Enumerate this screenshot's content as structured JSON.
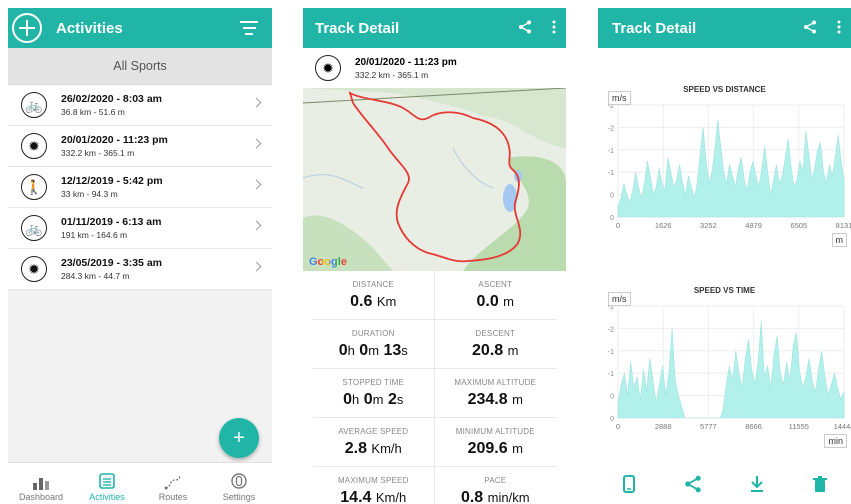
{
  "colors": {
    "accent": "#21b5a7",
    "track": "#e53935",
    "chart_fill": "#b2f0ec"
  },
  "screen1": {
    "title": "Activities",
    "subheader": "All Sports",
    "activities": [
      {
        "icon": "bicycle-icon",
        "date": "26/02/2020 - 8:03 am",
        "distance": "36.8 km - 51.6 m"
      },
      {
        "icon": "wheel-icon",
        "date": "20/01/2020 - 11:23 pm",
        "distance": "332.2 km - 365.1 m"
      },
      {
        "icon": "hiker-icon",
        "date": "12/12/2019 - 5:42 pm",
        "distance": "33 km - 94.3 m"
      },
      {
        "icon": "bicycle-icon",
        "date": "01/11/2019 - 6:13 am",
        "distance": "191 km - 164.6 m"
      },
      {
        "icon": "wheel-icon",
        "date": "23/05/2019 - 3:35 am",
        "distance": "284.3 km - 44.7 m"
      }
    ],
    "fab": "+",
    "nav": [
      {
        "label": "Dashboard",
        "icon": "bar-chart-icon"
      },
      {
        "label": "Activities",
        "icon": "list-icon"
      },
      {
        "label": "Routes",
        "icon": "route-icon"
      },
      {
        "label": "Settings",
        "icon": "settings-icon"
      }
    ]
  },
  "screen2": {
    "title": "Track Detail",
    "date": "20/01/2020 - 11:23 pm",
    "distance": "332.2 km - 365.1 m",
    "map_logo": "Google",
    "stats": [
      {
        "label": "DISTANCE",
        "value": "0.6",
        "unit": "Km"
      },
      {
        "label": "ASCENT",
        "value": "0.0",
        "unit": "m"
      },
      {
        "label": "DURATION",
        "h": "0",
        "m": "0",
        "s": "13"
      },
      {
        "label": "DESCENT",
        "value": "20.8",
        "unit": "m"
      },
      {
        "label": "STOPPED TIME",
        "h": "0",
        "m": "0",
        "s": "2"
      },
      {
        "label": "MAXIMUM ALTITUDE",
        "value": "234.8",
        "unit": "m"
      },
      {
        "label": "AVERAGE SPEED",
        "value": "2.8",
        "unit": "Km/h"
      },
      {
        "label": "MINIMUM ALTITUDE",
        "value": "209.6",
        "unit": "m"
      },
      {
        "label": "MAXIMUM SPEED",
        "value": "14.4",
        "unit": "Km/h"
      },
      {
        "label": "PACE",
        "value": "0.8",
        "unit": "min/km"
      }
    ],
    "time_units": {
      "h": "h",
      "m": "m",
      "s": "s"
    }
  },
  "screen3": {
    "title": "Track Detail",
    "chart_data": [
      {
        "type": "area",
        "title": "SPEED VS DISTANCE",
        "ylabel": "m/s",
        "xlabel": "m",
        "yticks": [
          "-2",
          "-2",
          "-1",
          "-1",
          "0",
          "0"
        ],
        "xticks": [
          "0",
          "1626",
          "3252",
          "4879",
          "6505",
          "8131"
        ],
        "xlim": [
          0,
          8131
        ],
        "series": [
          {
            "values": [
              0.3,
              0.5,
              0.9,
              0.6,
              0.4,
              0.7,
              1.2,
              0.8,
              0.5,
              0.9,
              1.5,
              1.1,
              0.6,
              0.8,
              1.3,
              0.9,
              0.7,
              1.6,
              1.2,
              0.8,
              1.0,
              1.4,
              0.9,
              0.6,
              1.1,
              0.8,
              0.5,
              0.9,
              1.7,
              2.4,
              1.5,
              0.9,
              1.2,
              1.8,
              2.6,
              1.9,
              1.2,
              0.9,
              1.4,
              1.1,
              0.8,
              1.3,
              1.6,
              1.0,
              0.7,
              1.2,
              1.5,
              1.1,
              0.8,
              1.3,
              1.9,
              1.2,
              0.6,
              1.0,
              1.4,
              0.9,
              1.1,
              1.6,
              2.1,
              1.3,
              0.8,
              1.0,
              1.5,
              1.2,
              2.3,
              1.7,
              1.0,
              1.3,
              1.8,
              2.0,
              1.2,
              0.9,
              1.4,
              1.1,
              1.6,
              2.2,
              1.5,
              1.0
            ]
          }
        ]
      },
      {
        "type": "area",
        "title": "SPEED VS TIME",
        "ylabel": "m/s",
        "xlabel": "min",
        "yticks": [
          "-2",
          "-2",
          "-1",
          "-1",
          "0",
          "0"
        ],
        "xticks": [
          "0",
          "2888",
          "5777",
          "8666",
          "11555",
          "14444"
        ],
        "xlim": [
          0,
          14444
        ],
        "series": [
          {
            "values": [
              0.4,
              0.9,
              1.2,
              0.6,
              1.5,
              0.8,
              1.1,
              0.5,
              1.3,
              0.7,
              1.6,
              1.0,
              0.4,
              0.9,
              1.4,
              0.6,
              1.2,
              2.4,
              1.0,
              0.6,
              0.3,
              0.0,
              0.0,
              0.0,
              0.0,
              0.0,
              0.0,
              0.0,
              0.0,
              0.0,
              0.0,
              0.0,
              0.0,
              0.2,
              0.9,
              1.4,
              1.0,
              1.8,
              1.2,
              0.8,
              1.6,
              2.1,
              1.3,
              0.9,
              1.5,
              2.6,
              1.1,
              1.4,
              0.8,
              1.7,
              2.2,
              1.2,
              0.9,
              1.5,
              1.0,
              1.9,
              2.3,
              1.3,
              0.8,
              1.1,
              1.6,
              1.0,
              0.7,
              1.3,
              1.8,
              1.1,
              0.6,
              0.9,
              1.2,
              0.8,
              0.5,
              0.7
            ]
          }
        ]
      }
    ],
    "actions": [
      {
        "icon": "phone-icon"
      },
      {
        "icon": "share-icon"
      },
      {
        "icon": "download-icon"
      },
      {
        "icon": "trash-icon"
      }
    ]
  }
}
